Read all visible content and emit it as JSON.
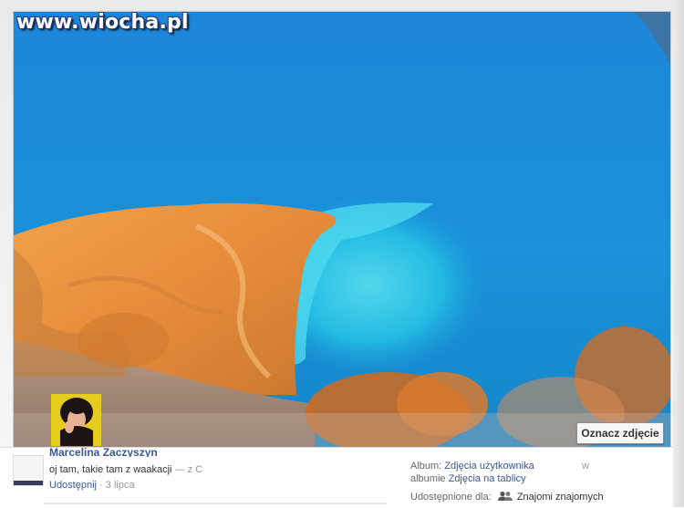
{
  "watermark": "www.wiocha.pl",
  "photo": {
    "tag_button": "Oznacz zdjęcie"
  },
  "post": {
    "author": "Marcelina Zaczyszyn",
    "caption": "oj tam, takie tam z waakacji",
    "caption_suffix": "— z C",
    "share_link": "Udostępnij",
    "separator": " · ",
    "date": "3 lipca"
  },
  "album": {
    "label": "Album:",
    "name": "Zdjęcia użytkownika",
    "w": "w",
    "line2_prefix": "albumie",
    "line2_link": "Zdjęcia na tablicy"
  },
  "sharing": {
    "label": "Udostępnione dla:",
    "icon": "friends-icon",
    "value": "Znajomi znajomych"
  },
  "colors": {
    "sea": "#1c83d7",
    "lagoon": "#3fd0e8",
    "rock": "#e89a45",
    "link": "#3b5998"
  }
}
